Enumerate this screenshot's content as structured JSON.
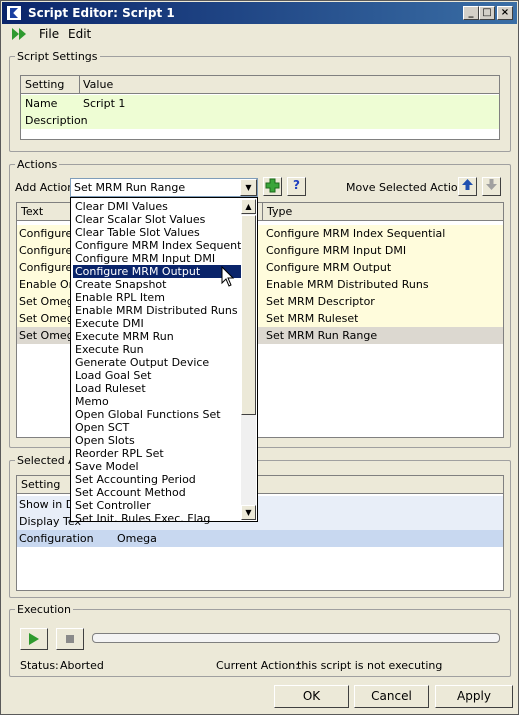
{
  "window": {
    "title": "Script Editor: Script 1"
  },
  "menu": {
    "file": "File",
    "edit": "Edit"
  },
  "script_settings": {
    "group_label": "Script Settings",
    "columns": [
      "Setting",
      "Value"
    ],
    "rows": [
      {
        "setting": "Name",
        "value": "Script 1"
      },
      {
        "setting": "Description",
        "value": ""
      }
    ]
  },
  "actions": {
    "group_label": "Actions",
    "add_action_label": "Add Action",
    "add_action_value": "Set MRM Run Range",
    "move_label": "Move Selected Action:",
    "columns": [
      "Text",
      "Type"
    ],
    "rows": [
      {
        "text": "Configure",
        "type": "Configure MRM Index Sequential"
      },
      {
        "text": "Configure",
        "type": "Configure MRM Input DMI"
      },
      {
        "text": "Configure",
        "type": "Configure MRM Output"
      },
      {
        "text": "Enable Om",
        "type": "Enable MRM Distributed Runs"
      },
      {
        "text": "Set Omega",
        "type": "Set MRM Descriptor"
      },
      {
        "text": "Set Omega",
        "type": "Set MRM Ruleset"
      },
      {
        "text": "Set Omega",
        "type": "Set MRM Run Range"
      }
    ]
  },
  "dropdown_items": [
    "Clear DMI Values",
    "Clear Scalar Slot Values",
    "Clear Table Slot Values",
    "Configure MRM Index Sequential",
    "Configure MRM Input DMI",
    "Configure MRM Output",
    "Create Snapshot",
    "Enable RPL Item",
    "Enable MRM Distributed Runs",
    "Execute DMI",
    "Execute MRM Run",
    "Execute Run",
    "Generate Output Device",
    "Load Goal Set",
    "Load Ruleset",
    "Memo",
    "Open Global Functions Set",
    "Open SCT",
    "Open Slots",
    "Reorder RPL Set",
    "Save Model",
    "Set Accounting Period",
    "Set Account Method",
    "Set Controller",
    "Set Init. Rules Exec. Flag"
  ],
  "selected_action": {
    "group_label": "Selected Ac",
    "columns": [
      "Setting"
    ],
    "rows": [
      {
        "setting": "Show in Da",
        "value": ""
      },
      {
        "setting": "Display Tex",
        "value": ""
      },
      {
        "setting": "Configuration",
        "value": "Omega"
      }
    ]
  },
  "execution": {
    "group_label": "Execution",
    "status_label": "Status:",
    "status_value": "Aborted",
    "current_action_label": "Current Action:",
    "current_action_value": "this script is not executing",
    "progress": 0
  },
  "buttons": {
    "ok": "OK",
    "cancel": "Cancel",
    "apply": "Apply"
  },
  "colors": {
    "row_yellow": "#fffcdc",
    "row_green": "#eefdd4",
    "row_selected": "#c8d8f0",
    "title_blue": "#0a246a"
  }
}
